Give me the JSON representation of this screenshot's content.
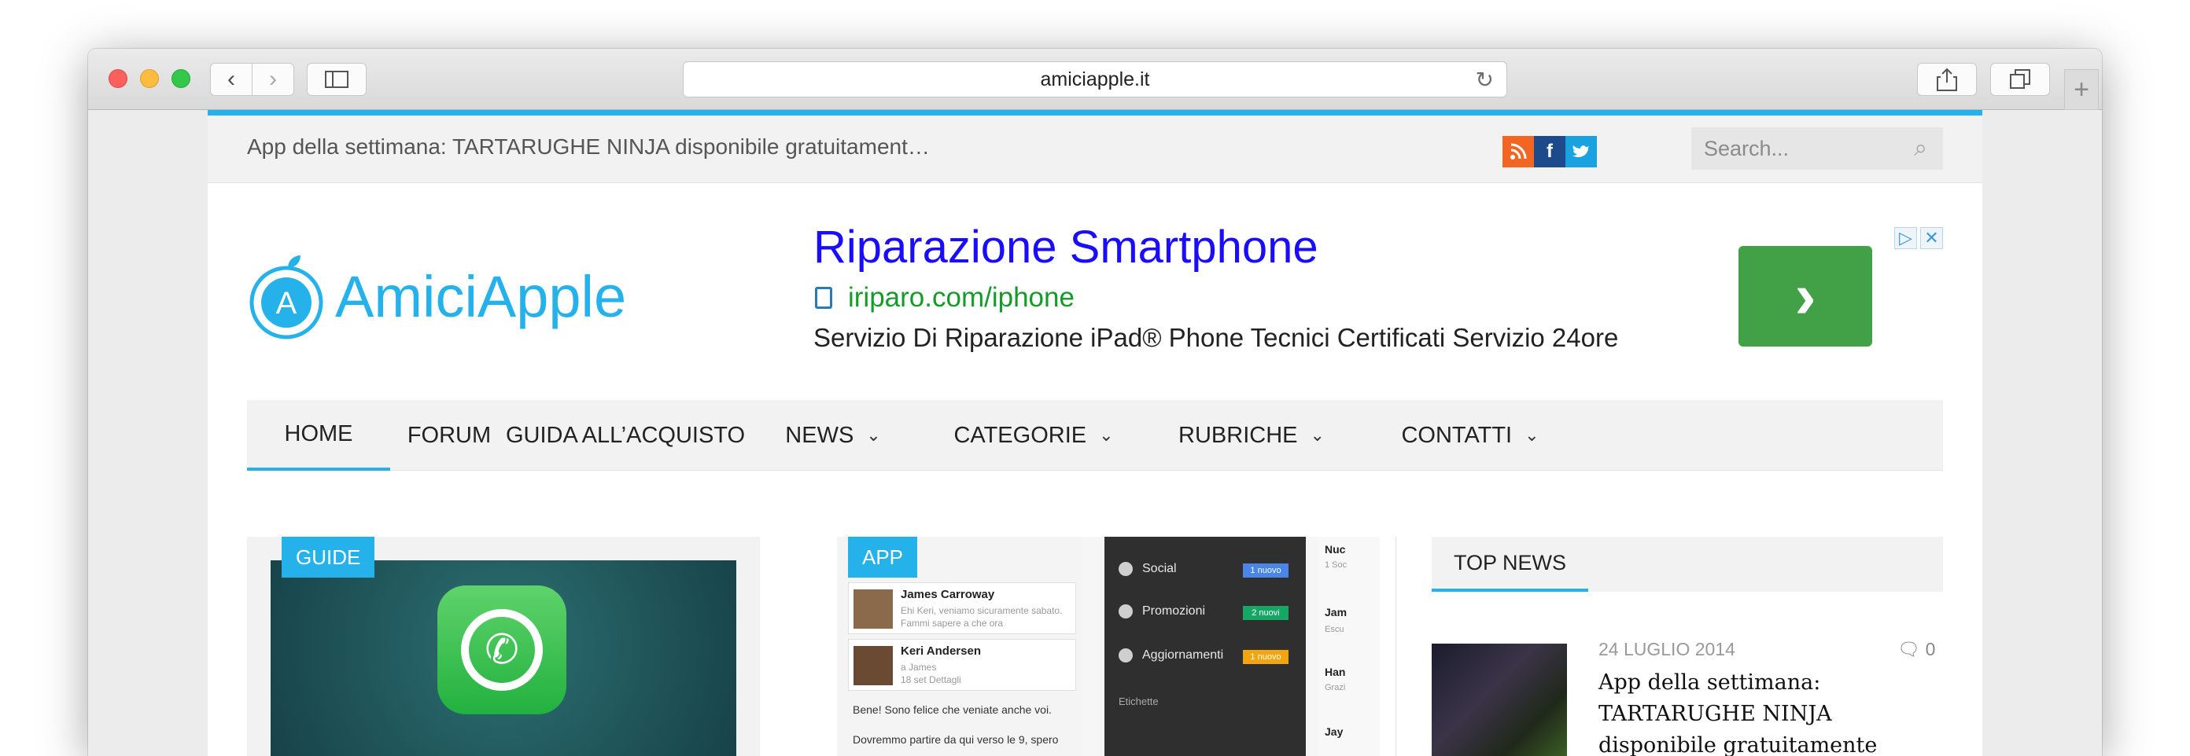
{
  "browser": {
    "address": "amiciapple.it"
  },
  "topbar": {
    "ticker": "App della settimana: TARTARUGHE NINJA disponibile gratuitament…",
    "search_placeholder": "Search...",
    "social": [
      "rss-icon",
      "facebook-icon",
      "twitter-icon"
    ]
  },
  "logo": {
    "text": "AmiciApple",
    "mark": "A"
  },
  "ad": {
    "title": "Riparazione Smartphone",
    "url": "iriparo.com/iphone",
    "description": "Servizio Di Riparazione iPad® Phone Tecnici Certificati Servizio 24ore",
    "button_glyph": "›"
  },
  "nav": {
    "items": [
      {
        "label": "HOME"
      },
      {
        "label": "FORUM"
      },
      {
        "label": "GUIDA ALL’ACQUISTO"
      },
      {
        "label": "NEWS"
      },
      {
        "label": "CATEGORIE"
      },
      {
        "label": "RUBRICHE"
      },
      {
        "label": "CONTATTI"
      }
    ]
  },
  "cards": {
    "guide_tag": "GUIDE",
    "app_tag": "APP"
  },
  "mail": {
    "msg1_name": "James Carroway",
    "msg1_sub": "Ehi Keri, veniamo sicuramente sabato.",
    "msg1_sub2": "Fammi sapere a che ora",
    "msg2_name": "Keri Andersen",
    "msg2_sub": "a James",
    "msg2_sub2": "18 set  Dettagli",
    "body1": "Bene! Sono felice che veniate anche voi.",
    "body2": "Dovremmo partire da qui verso le 9, spero",
    "social": "Social",
    "social_badge": "1 nuovo",
    "promo": "Promozioni",
    "promo_badge": "2 nuovi",
    "updates": "Aggiornamenti",
    "updates_badge": "1 nuovo",
    "labels": "Etichette",
    "r1": "Nuc",
    "r1s": "1 Soc",
    "r2": "Jam",
    "r2s": "Escu",
    "r3": "Han",
    "r3s": "Grazi",
    "r4": "Jay"
  },
  "topnews": {
    "label": "TOP NEWS",
    "date": "24 LUGLIO 2014",
    "comments": "0",
    "title": "App della settimana: TARTARUGHE NINJA disponibile gratuitamente"
  },
  "colors": {
    "accent": "#25b2ea",
    "ad_green": "#42a047",
    "rss": "#f26522",
    "facebook": "#1c4a8b",
    "twitter": "#1aa2e0"
  }
}
